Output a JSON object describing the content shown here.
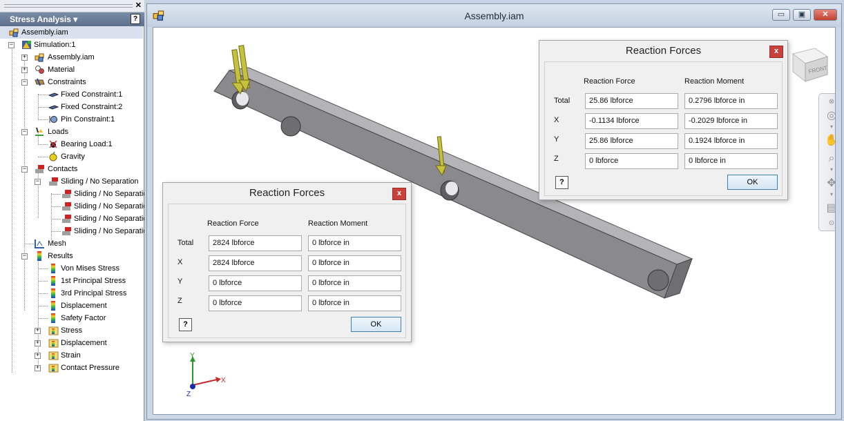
{
  "browser": {
    "title": "Stress Analysis ▾",
    "root": "Assembly.iam",
    "items": [
      {
        "label": "Simulation:1",
        "icon": "simulation-icon"
      },
      {
        "label": "Assembly.iam",
        "icon": "assembly-icon"
      },
      {
        "label": "Material",
        "icon": "material-icon"
      },
      {
        "label": "Constraints",
        "icon": "constraints-icon"
      },
      {
        "label": "Fixed Constraint:1",
        "icon": "fixed-constraint-icon"
      },
      {
        "label": "Fixed Constraint:2",
        "icon": "fixed-constraint-icon"
      },
      {
        "label": "Pin Constraint:1",
        "icon": "pin-constraint-icon"
      },
      {
        "label": "Loads",
        "icon": "loads-icon"
      },
      {
        "label": "Bearing Load:1",
        "icon": "bearing-load-icon"
      },
      {
        "label": "Gravity",
        "icon": "gravity-icon"
      },
      {
        "label": "Contacts",
        "icon": "contacts-icon"
      },
      {
        "label": "Sliding / No Separation",
        "icon": "contact-icon"
      },
      {
        "label": "Sliding / No Separatio",
        "icon": "contact-icon"
      },
      {
        "label": "Sliding / No Separatio",
        "icon": "contact-icon"
      },
      {
        "label": "Sliding / No Separatio",
        "icon": "contact-icon"
      },
      {
        "label": "Sliding / No Separatio",
        "icon": "contact-icon"
      },
      {
        "label": "Mesh",
        "icon": "mesh-icon"
      },
      {
        "label": "Results",
        "icon": "results-icon"
      },
      {
        "label": "Von Mises Stress",
        "icon": "result-plot-icon"
      },
      {
        "label": "1st Principal Stress",
        "icon": "result-plot-icon"
      },
      {
        "label": "3rd Principal Stress",
        "icon": "result-plot-icon"
      },
      {
        "label": "Displacement",
        "icon": "result-plot-icon"
      },
      {
        "label": "Safety Factor",
        "icon": "result-plot-icon"
      },
      {
        "label": "Stress",
        "icon": "result-folder-icon"
      },
      {
        "label": "Displacement",
        "icon": "result-folder-icon"
      },
      {
        "label": "Strain",
        "icon": "result-folder-icon"
      },
      {
        "label": "Contact Pressure",
        "icon": "result-folder-icon"
      }
    ]
  },
  "window": {
    "title": "Assembly.iam",
    "minimize": "▭",
    "maximize": "▣",
    "close": "✕"
  },
  "viewcube": {
    "face": "FRONT"
  },
  "axes": {
    "x": "X",
    "y": "Y",
    "z": "Z"
  },
  "dialog1": {
    "title": "Reaction Forces",
    "close": "x",
    "col_force": "Reaction Force",
    "col_moment": "Reaction Moment",
    "rows": [
      {
        "label": "Total",
        "force": "25.86 lbforce",
        "moment": "0.2796 lbforce in"
      },
      {
        "label": "X",
        "force": "-0.1134 lbforce",
        "moment": "-0.2029 lbforce in"
      },
      {
        "label": "Y",
        "force": "25.86 lbforce",
        "moment": "0.1924 lbforce in"
      },
      {
        "label": "Z",
        "force": "0 lbforce",
        "moment": "0 lbforce in"
      }
    ],
    "ok": "OK"
  },
  "dialog2": {
    "title": "Reaction Forces",
    "close": "x",
    "col_force": "Reaction Force",
    "col_moment": "Reaction Moment",
    "rows": [
      {
        "label": "Total",
        "force": "2824 lbforce",
        "moment": "0 lbforce in"
      },
      {
        "label": "X",
        "force": "2824 lbforce",
        "moment": "0 lbforce in"
      },
      {
        "label": "Y",
        "force": "0 lbforce",
        "moment": "0 lbforce in"
      },
      {
        "label": "Z",
        "force": "0 lbforce",
        "moment": "0 lbforce in"
      }
    ],
    "ok": "OK"
  },
  "colors": {
    "beam_top": "#b9b9bd",
    "beam_side": "#7a7a7e",
    "load_arrow": "#c9c23a",
    "x_axis": "#d03030",
    "y_axis": "#30a030",
    "z_axis": "#2030c0"
  }
}
